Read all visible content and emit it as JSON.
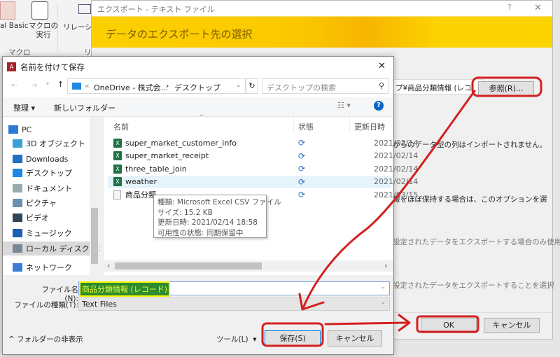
{
  "ribbon": {
    "vba_label": "al Basic",
    "macro_run_label": "マクロの\n実行",
    "macro_run_1": "マクロの",
    "macro_run_2": "実行",
    "group_macro": "マクロ",
    "relation_label": "リレーショ",
    "group_rel": "リ"
  },
  "export_dialog": {
    "title": "エクスポート - テキスト ファイル",
    "banner": "データのエクスポート先の選択",
    "path_value": "プ¥商品分類情報 (レコ",
    "browse_label": "参照(R)...",
    "text1": "からのデータ型の列はインポートされません。",
    "text2": "報をほぼ保持する場合は、このオプションを選",
    "text3": "設定されたデータをエクスポートする場合のみ使用",
    "text4": "設定されたデータをエクスポートすることを選択",
    "ok_label": "OK",
    "cancel_label": "キャンセル",
    "help": "?",
    "close": "✕"
  },
  "save_dialog": {
    "title": "名前を付けて保存",
    "close": "✕",
    "address": {
      "prefix": "«",
      "part1": "OneDrive - 株式会...",
      "sep": "›",
      "part2": "デスクトップ"
    },
    "search_placeholder": "デスクトップの検索",
    "toolbar": {
      "organize": "整理 ▾",
      "new_folder": "新しいフォルダー"
    },
    "sidebar": [
      {
        "label": "PC",
        "icon": "pc-icon"
      },
      {
        "label": "3D オブジェクト",
        "icon": "3d-objects-icon"
      },
      {
        "label": "Downloads",
        "icon": "download-icon"
      },
      {
        "label": "デスクトップ",
        "icon": "desktop-icon"
      },
      {
        "label": "ドキュメント",
        "icon": "documents-icon"
      },
      {
        "label": "ピクチャ",
        "icon": "pictures-icon"
      },
      {
        "label": "ビデオ",
        "icon": "video-icon"
      },
      {
        "label": "ミュージック",
        "icon": "music-icon"
      },
      {
        "label": "ローカル ディスク (C",
        "icon": "drive-icon"
      },
      {
        "label": "ネットワーク",
        "icon": "network-icon"
      }
    ],
    "columns": {
      "name": "名前",
      "status": "状態",
      "modified": "更新日時"
    },
    "files": [
      {
        "name": "super_market_customer_info",
        "type": "excel",
        "status": "sync",
        "modified": "2021/02/14"
      },
      {
        "name": "super_market_receipt",
        "type": "excel",
        "status": "sync",
        "modified": "2021/02/14"
      },
      {
        "name": "three_table_join",
        "type": "excel",
        "status": "sync",
        "modified": "2021/02/14"
      },
      {
        "name": "weather",
        "type": "excel",
        "status": "sync",
        "modified": "2021/02/14",
        "hovered": true
      },
      {
        "name": "商品分類",
        "type": "text",
        "status": "sync",
        "modified": "2021/03/15"
      }
    ],
    "tooltip": [
      "種類: Microsoft Excel CSV ファイル",
      "サイズ: 15.2 KB",
      "更新日時: 2021/02/14 18:58",
      "可用性の状態: 同期保留中"
    ],
    "filename_label": "ファイル名(N):",
    "filename_value": "商品分類情報 (レコード)",
    "filetype_label": "ファイルの種類(T):",
    "filetype_value": "Text Files",
    "hide_folders": "^ フォルダーの非表示",
    "tools": "ツール(L)  ▾",
    "save_label": "保存(S)",
    "cancel_label": "キャンセル"
  },
  "annotation_color": "#d42020"
}
